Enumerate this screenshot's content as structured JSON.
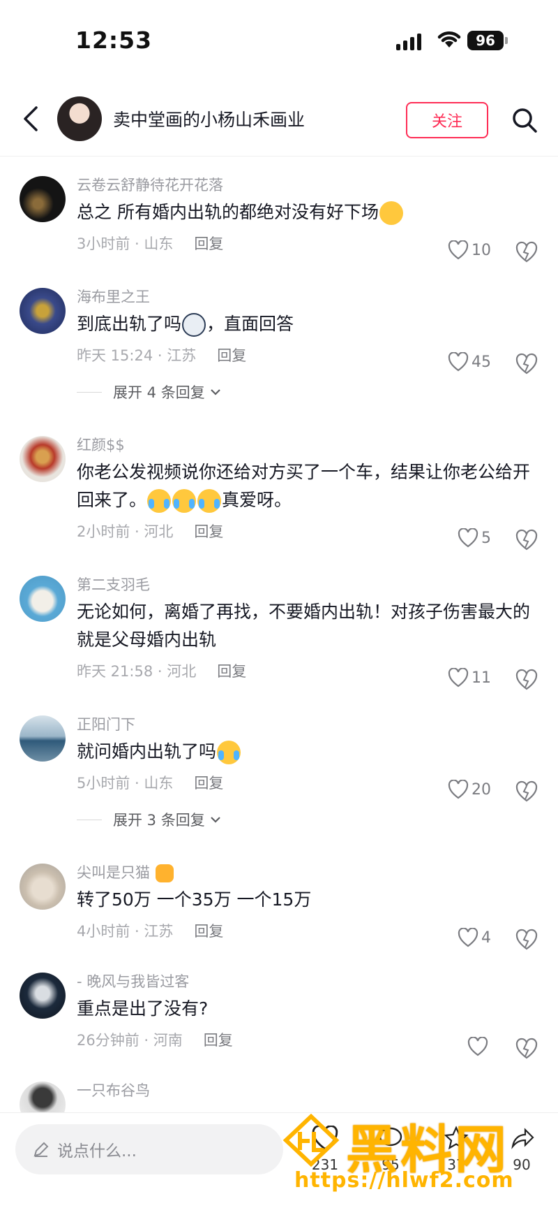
{
  "status_bar": {
    "time": "12:53",
    "battery": "96"
  },
  "header": {
    "title": "卖中堂画的小杨山禾画业",
    "follow_label": "关注"
  },
  "comments": [
    {
      "username": "云卷云舒静待花开花落",
      "text_parts": [
        "总之 所有婚内出轨的都绝对没有好下场"
      ],
      "time_location": "3小时前 · 山东",
      "reply_label": "回复",
      "likes": "10"
    },
    {
      "username": "海布里之王",
      "text_parts": [
        "到底出轨了吗",
        "，直面回答"
      ],
      "time_location": "昨天 15:24 · 江苏",
      "reply_label": "回复",
      "likes": "45",
      "expand": "展开 4 条回复"
    },
    {
      "username": "红颜$$",
      "text_parts": [
        "你老公发视频说你还给对方买了一个车，结果让你老公给开回来了。",
        "真爱呀。"
      ],
      "time_location": "2小时前 · 河北",
      "reply_label": "回复",
      "likes": "5"
    },
    {
      "username": "第二支羽毛",
      "text_parts": [
        "无论如何，离婚了再找，不要婚内出轨！对孩子伤害最大的就是父母婚内出轨"
      ],
      "time_location": "昨天 21:58 · 河北",
      "reply_label": "回复",
      "likes": "11"
    },
    {
      "username": "正阳门下",
      "text_parts": [
        "就问婚内出轨了吗"
      ],
      "time_location": "5小时前 · 山东",
      "reply_label": "回复",
      "likes": "20",
      "expand": "展开 3 条回复"
    },
    {
      "username": "尖叫是只猫",
      "text_parts": [
        "转了50万 一个35万 一个15万"
      ],
      "time_location": "4小时前 · 江苏",
      "reply_label": "回复",
      "likes": "4"
    },
    {
      "username": "- 晚风与我皆过客",
      "text_parts": [
        "重点是出了没有?"
      ],
      "time_location": "26分钟前 · 河南",
      "reply_label": "回复",
      "likes": ""
    },
    {
      "username": "一只布谷鸟"
    }
  ],
  "bottom_bar": {
    "input_placeholder": "说点什么...",
    "counts": [
      "231",
      "95",
      "37",
      "90"
    ]
  },
  "watermark": {
    "title": "黑料网",
    "url": "https://hlwf2.com"
  },
  "colors": {
    "accent": "#fe2c55",
    "watermark": "#ffb400"
  }
}
